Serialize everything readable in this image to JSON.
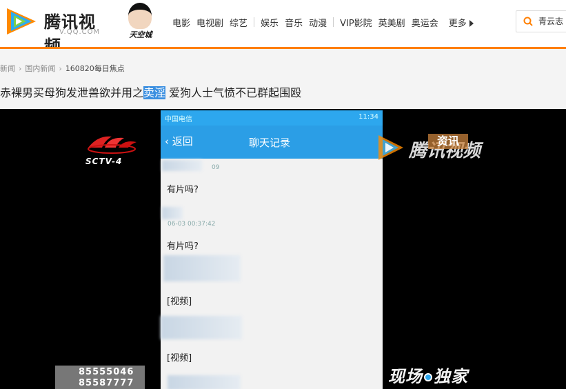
{
  "header": {
    "logo_title": "腾讯视频",
    "logo_subtitle": "V.QQ.COM",
    "promo_text": "天空城",
    "nav": [
      "电影",
      "电视剧",
      "综艺",
      "娱乐",
      "音乐",
      "动漫",
      "VIP影院",
      "英美剧",
      "奥运会"
    ],
    "more_label": "更多",
    "search_value": "青云志",
    "accent_color": "#ff7f00"
  },
  "breadcrumb": [
    "新闻",
    "国内新闻",
    "160820每日焦点"
  ],
  "title": {
    "before": "赤裸男买母狗发泄兽欲并用之",
    "highlight": "卖淫",
    "after": " 爱狗人士气愤不已群起围殴"
  },
  "video": {
    "channel_logo_text": "SCTV-4",
    "phone_status_carrier": "中国电信",
    "phone_status_time": "11:34",
    "back_label": "返回",
    "chat_title": "聊天记录",
    "messages": [
      {
        "meta": "09",
        "text": "有片吗?"
      },
      {
        "meta": "06-03 00:37:42",
        "text": "有片吗?"
      },
      {
        "meta": "",
        "text": "[视频]"
      },
      {
        "meta": "",
        "text": "[视频]"
      }
    ],
    "watermark_text": "腾讯视频",
    "watermark_badge": "资讯",
    "phone_numbers": [
      "85555046",
      "85587777"
    ],
    "live_badge_left": "现场",
    "live_badge_right": "独家"
  }
}
